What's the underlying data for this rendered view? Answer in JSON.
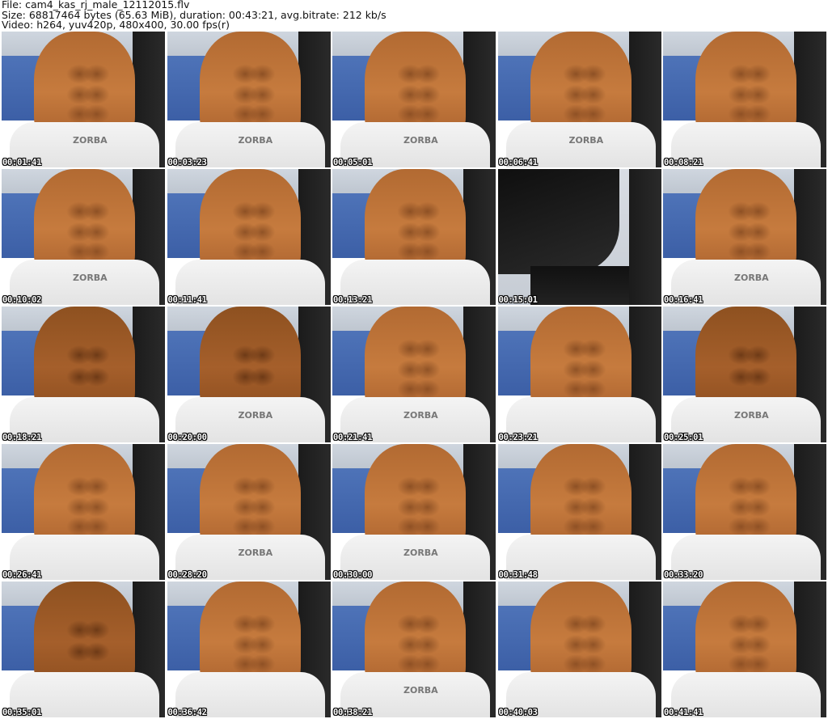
{
  "header": {
    "file_line": "File: cam4_kas_rj_male_12112015.flv",
    "size_line": "Size: 68817464 bytes (65.63 MiB), duration: 00:43:21, avg.bitrate: 212 kb/s",
    "video_line": "Video: h264, yuv420p, 480x400, 30.00 fps(r)"
  },
  "thumbnails": [
    {
      "timestamp": "00:01:41",
      "brand": "ZORBA"
    },
    {
      "timestamp": "00:03:23",
      "brand": "ZORBA"
    },
    {
      "timestamp": "00:05:01",
      "brand": "ZORBA"
    },
    {
      "timestamp": "00:06:41",
      "brand": "ZORBA"
    },
    {
      "timestamp": "00:08:21",
      "brand": ""
    },
    {
      "timestamp": "00:10:02",
      "brand": "ZORBA"
    },
    {
      "timestamp": "00:11:41",
      "brand": ""
    },
    {
      "timestamp": "00:13:21",
      "brand": ""
    },
    {
      "timestamp": "00:15:01",
      "brand": ""
    },
    {
      "timestamp": "00:16:41",
      "brand": "ZORBA"
    },
    {
      "timestamp": "00:18:21",
      "brand": ""
    },
    {
      "timestamp": "00:20:00",
      "brand": "ZORBA"
    },
    {
      "timestamp": "00:21:41",
      "brand": "ZORBA"
    },
    {
      "timestamp": "00:23:21",
      "brand": ""
    },
    {
      "timestamp": "00:25:01",
      "brand": "ZORBA"
    },
    {
      "timestamp": "00:26:41",
      "brand": ""
    },
    {
      "timestamp": "00:28:20",
      "brand": "ZORBA"
    },
    {
      "timestamp": "00:30:00",
      "brand": "ZORBA"
    },
    {
      "timestamp": "00:31:48",
      "brand": ""
    },
    {
      "timestamp": "00:33:20",
      "brand": ""
    },
    {
      "timestamp": "00:35:01",
      "brand": ""
    },
    {
      "timestamp": "00:36:42",
      "brand": ""
    },
    {
      "timestamp": "00:38:21",
      "brand": "ZORBA"
    },
    {
      "timestamp": "00:40:03",
      "brand": ""
    },
    {
      "timestamp": "00:41:41",
      "brand": ""
    }
  ],
  "colors": {
    "background": "#ffffff",
    "timestamp_text": "#ffffff",
    "timestamp_outline": "#000000",
    "header_text": "#111111"
  }
}
